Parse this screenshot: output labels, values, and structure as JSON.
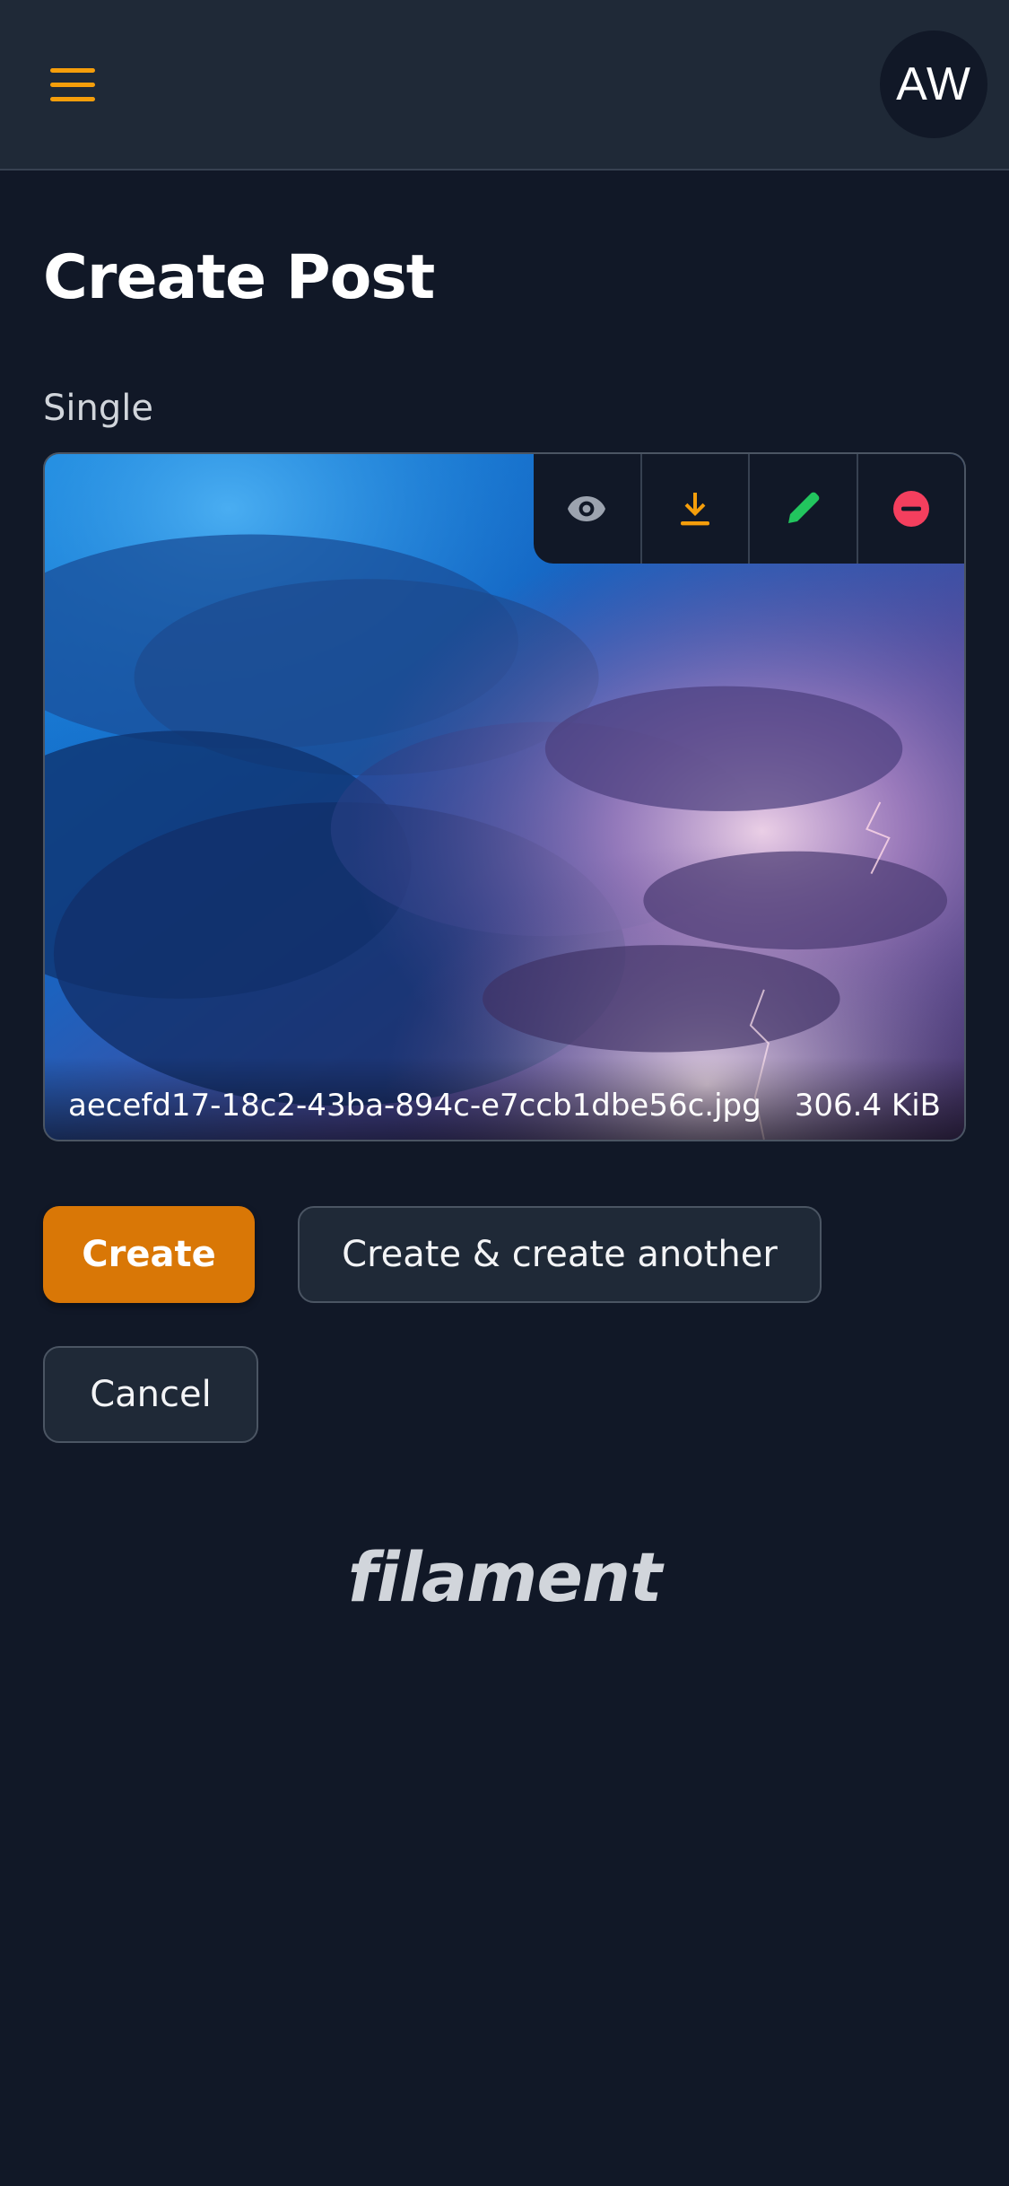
{
  "header": {
    "menu_icon": "hamburger-menu-icon",
    "avatar_initials": "AW",
    "accent_color": "#f59e0b"
  },
  "page": {
    "title": "Create Post"
  },
  "form": {
    "field_label": "Single",
    "file": {
      "name": "aecefd17-18c2-43ba-894c-e7ccb1dbe56c.jpg",
      "size": "306.4 KiB",
      "actions": [
        {
          "icon": "eye-icon",
          "color": "#9ca3af"
        },
        {
          "icon": "download-icon",
          "color": "#f59e0b"
        },
        {
          "icon": "pencil-icon",
          "color": "#22c55e"
        },
        {
          "icon": "remove-icon",
          "color": "#f43f5e"
        }
      ]
    }
  },
  "actions": {
    "create_label": "Create",
    "create_another_label": "Create & create another",
    "cancel_label": "Cancel",
    "primary_color": "#d97706"
  },
  "footer": {
    "brand": "filament"
  }
}
